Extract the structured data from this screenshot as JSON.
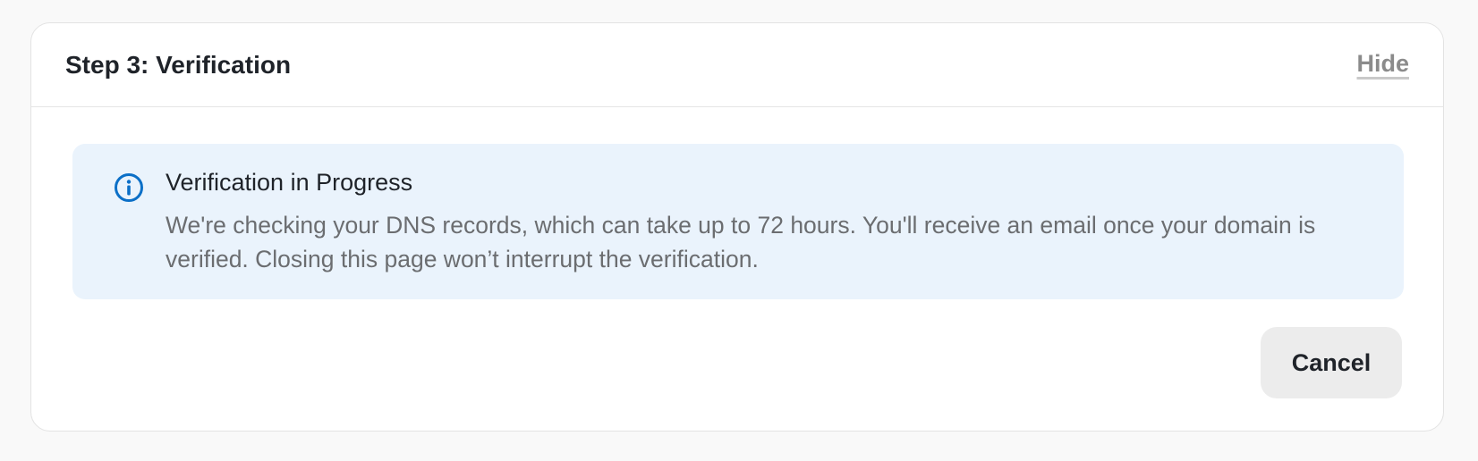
{
  "card": {
    "title": "Step 3: Verification",
    "hide_label": "Hide"
  },
  "notice": {
    "icon": "info-icon",
    "title": "Verification in Progress",
    "body": "We're checking your DNS records, which can take up to 72 hours. You'll receive an email once your domain is verified. Closing this page won’t interrupt the verification.",
    "accent_color": "#0b6fc7",
    "background_color": "#eaf3fc"
  },
  "actions": {
    "cancel_label": "Cancel"
  }
}
